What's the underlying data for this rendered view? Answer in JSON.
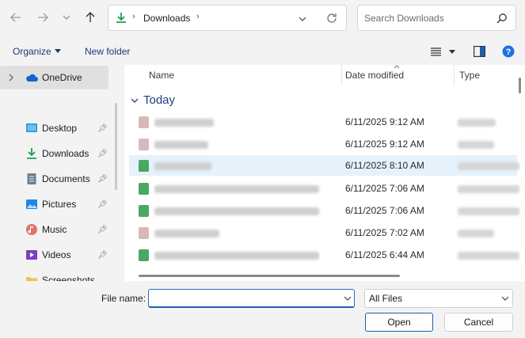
{
  "nav": {
    "back_icon": "arrow-left-icon",
    "forward_icon": "arrow-right-icon",
    "recent_icon": "chevron-down-icon",
    "up_icon": "arrow-up-icon"
  },
  "address": {
    "icon": "download-icon",
    "path": "Downloads",
    "refresh_icon": "refresh-icon"
  },
  "search": {
    "placeholder": "Search Downloads"
  },
  "toolbar": {
    "organize_label": "Organize",
    "new_folder_label": "New folder"
  },
  "sidebar": {
    "items": [
      {
        "label": "OneDrive",
        "icon": "cloud-icon",
        "selected": true
      },
      {
        "label": "Desktop",
        "icon": "desktop-icon"
      },
      {
        "label": "Downloads",
        "icon": "download-icon"
      },
      {
        "label": "Documents",
        "icon": "document-icon"
      },
      {
        "label": "Pictures",
        "icon": "picture-icon"
      },
      {
        "label": "Music",
        "icon": "music-icon"
      },
      {
        "label": "Videos",
        "icon": "video-icon"
      },
      {
        "label": "Screenshots",
        "icon": "folder-icon"
      }
    ]
  },
  "columns": {
    "name": "Name",
    "date": "Date modified",
    "type": "Type"
  },
  "group_title": "Today",
  "files": [
    {
      "date": "6/11/2025 9:12 AM",
      "kind": "red"
    },
    {
      "date": "6/11/2025 9:12 AM",
      "kind": "red"
    },
    {
      "date": "6/11/2025 8:10 AM",
      "kind": "green",
      "highlight": true
    },
    {
      "date": "6/11/2025 7:06 AM",
      "kind": "green"
    },
    {
      "date": "6/11/2025 7:06 AM",
      "kind": "green"
    },
    {
      "date": "6/11/2025 7:02 AM",
      "kind": "red"
    },
    {
      "date": "6/11/2025 6:44 AM",
      "kind": "green"
    }
  ],
  "bottom": {
    "file_name_label": "File name:",
    "file_name_value": "",
    "file_type": "All Files",
    "open_label": "Open",
    "cancel_label": "Cancel"
  },
  "colors": {
    "accent": "#1f5fae",
    "highlight_row": "#e5f1fb",
    "green_icon": "#2e9d4a",
    "red_icon": "#c9a9a9"
  }
}
